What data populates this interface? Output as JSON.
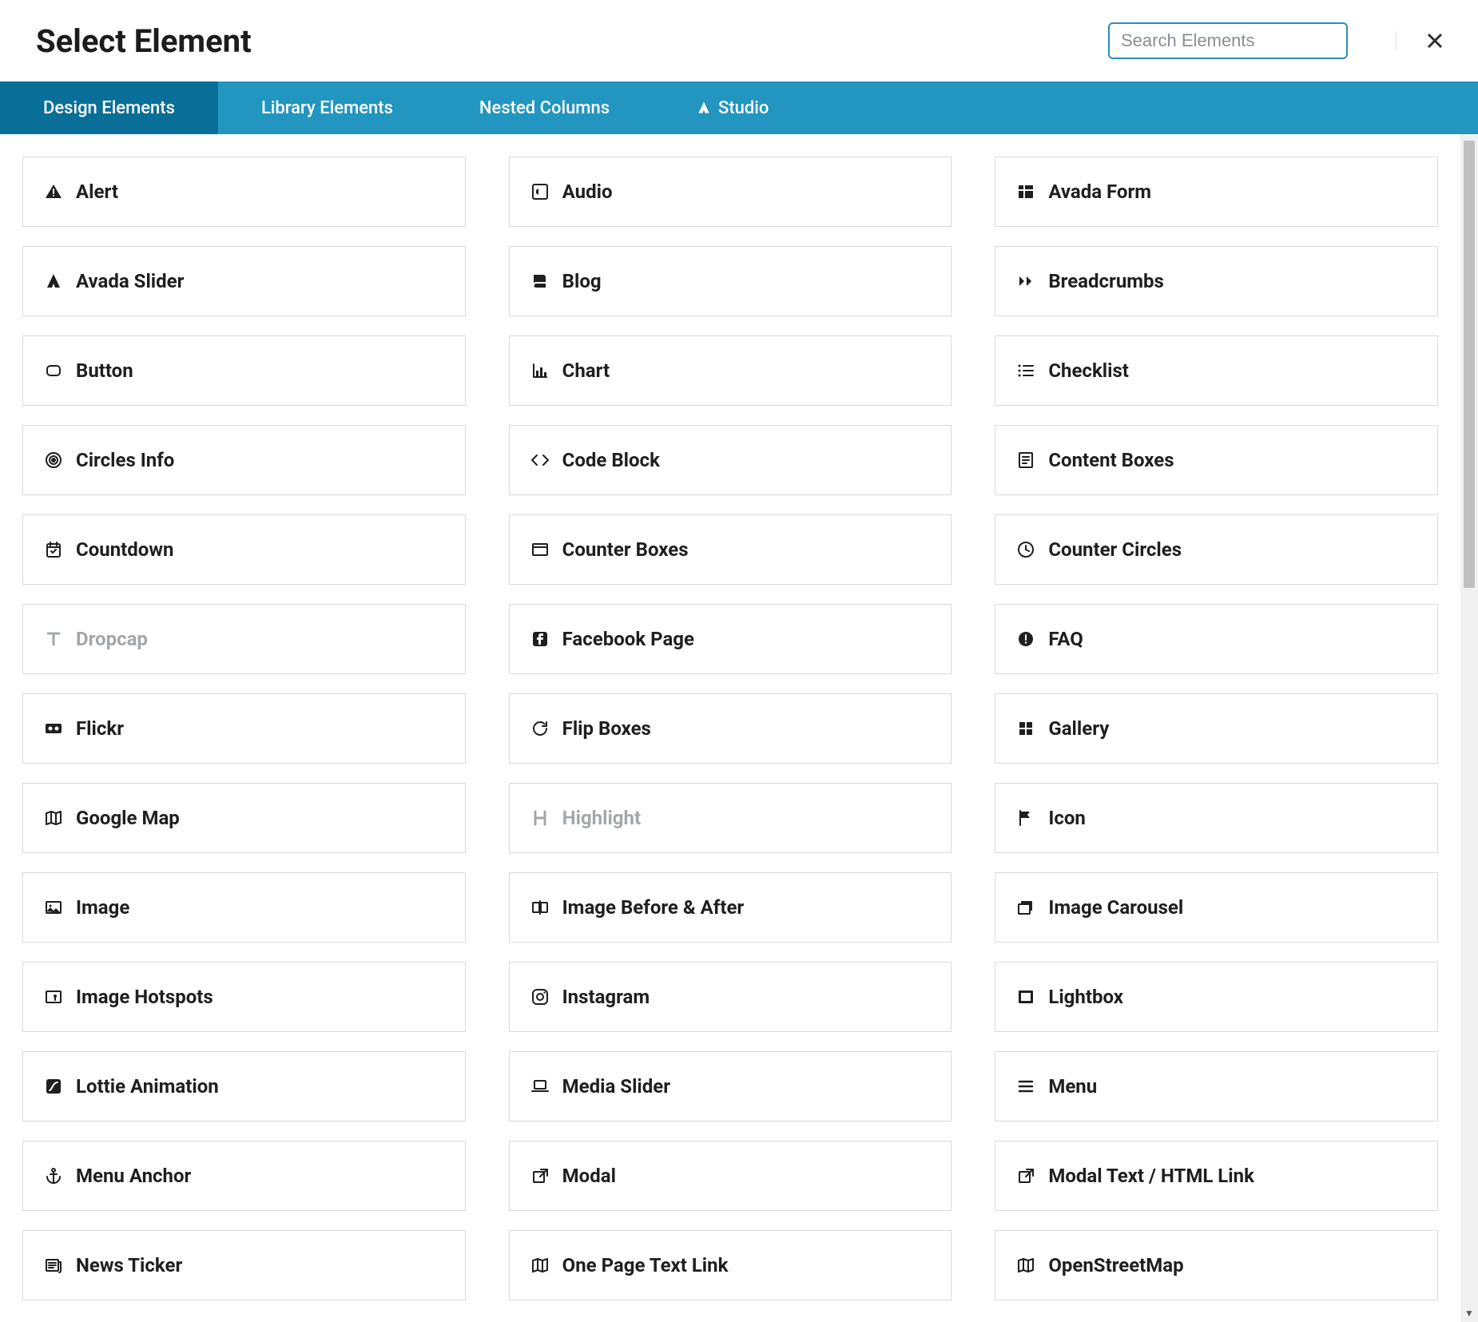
{
  "header": {
    "title": "Select Element",
    "search_placeholder": "Search Elements"
  },
  "tabs": [
    {
      "label": "Design Elements",
      "active": true
    },
    {
      "label": "Library Elements",
      "active": false
    },
    {
      "label": "Nested Columns",
      "active": false
    },
    {
      "label": "Studio",
      "active": false,
      "icon": "studio"
    }
  ],
  "elements": [
    {
      "label": "Alert",
      "icon": "warning"
    },
    {
      "label": "Audio",
      "icon": "audio"
    },
    {
      "label": "Avada Form",
      "icon": "form"
    },
    {
      "label": "Avada Slider",
      "icon": "avada"
    },
    {
      "label": "Blog",
      "icon": "book"
    },
    {
      "label": "Breadcrumbs",
      "icon": "chevrons"
    },
    {
      "label": "Button",
      "icon": "rounded-square"
    },
    {
      "label": "Chart",
      "icon": "bar-chart"
    },
    {
      "label": "Checklist",
      "icon": "checklist"
    },
    {
      "label": "Circles Info",
      "icon": "target"
    },
    {
      "label": "Code Block",
      "icon": "code"
    },
    {
      "label": "Content Boxes",
      "icon": "content-box"
    },
    {
      "label": "Countdown",
      "icon": "calendar-check"
    },
    {
      "label": "Counter Boxes",
      "icon": "window"
    },
    {
      "label": "Counter Circles",
      "icon": "clock"
    },
    {
      "label": "Dropcap",
      "icon": "type",
      "disabled": true
    },
    {
      "label": "Facebook Page",
      "icon": "facebook"
    },
    {
      "label": "FAQ",
      "icon": "exclaim-circle"
    },
    {
      "label": "Flickr",
      "icon": "flickr"
    },
    {
      "label": "Flip Boxes",
      "icon": "refresh"
    },
    {
      "label": "Gallery",
      "icon": "grid4"
    },
    {
      "label": "Google Map",
      "icon": "map"
    },
    {
      "label": "Highlight",
      "icon": "heading",
      "disabled": true
    },
    {
      "label": "Icon",
      "icon": "flag"
    },
    {
      "label": "Image",
      "icon": "image"
    },
    {
      "label": "Image Before & After",
      "icon": "image-compare"
    },
    {
      "label": "Image Carousel",
      "icon": "image-stack"
    },
    {
      "label": "Image Hotspots",
      "icon": "image-pin"
    },
    {
      "label": "Instagram",
      "icon": "instagram"
    },
    {
      "label": "Lightbox",
      "icon": "frame"
    },
    {
      "label": "Lottie Animation",
      "icon": "lottie"
    },
    {
      "label": "Media Slider",
      "icon": "laptop"
    },
    {
      "label": "Menu",
      "icon": "bars"
    },
    {
      "label": "Menu Anchor",
      "icon": "anchor"
    },
    {
      "label": "Modal",
      "icon": "external"
    },
    {
      "label": "Modal Text / HTML Link",
      "icon": "external"
    },
    {
      "label": "News Ticker",
      "icon": "news"
    },
    {
      "label": "One Page Text Link",
      "icon": "map"
    },
    {
      "label": "OpenStreetMap",
      "icon": "map"
    }
  ]
}
